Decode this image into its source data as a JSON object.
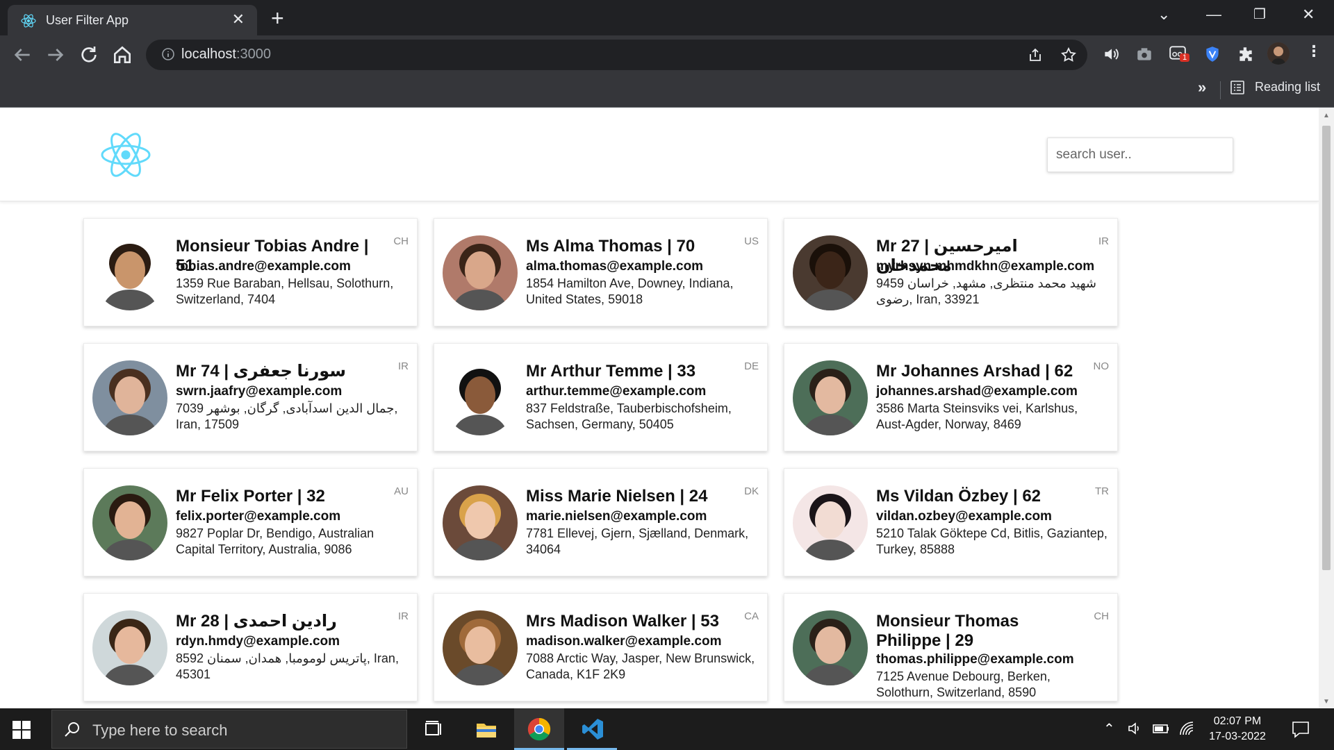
{
  "browser": {
    "tab_title": "User Filter App",
    "url_host": "localhost",
    "url_port": ":3000",
    "reading_list": "Reading list",
    "extension_badge": "1"
  },
  "app": {
    "search_placeholder": "search user.."
  },
  "users": [
    {
      "name": "Monsieur Tobias Andre | 51",
      "email": "tobias.andre@example.com",
      "address": "1359 Rue Baraban, Hellsau, Solothurn, Switzerland, 7404",
      "nat": "CH",
      "skin": "#c9956b",
      "hair": "#2b1c12",
      "bg": "#ffffff"
    },
    {
      "name": "Ms Alma Thomas | 70",
      "email": "alma.thomas@example.com",
      "address": "1854 Hamilton Ave, Downey, Indiana, United States, 59018",
      "nat": "US",
      "skin": "#d9a78a",
      "hair": "#3a2418",
      "bg": "#b07a6a"
    },
    {
      "name": "Mr 27 | امیرحسین محمدخان",
      "email": "myrhsyn.mhmdkhn@example.com",
      "address": "9459 شهید محمد منتظری, مشهد, خراسان رضوی, Iran, 33921",
      "nat": "IR",
      "skin": "#3b2518",
      "hair": "#1a1009",
      "bg": "#4a3a30"
    },
    {
      "name": "Mr 74 | سورنا جعفری",
      "email": "swrn.jaafry@example.com",
      "address": "7039 جمال الدین اسدآبادی, گرگان, بوشهر, Iran, 17509",
      "nat": "IR",
      "skin": "#e0b49a",
      "hair": "#4a3020",
      "bg": "#7f8f9f"
    },
    {
      "name": "Mr Arthur Temme | 33",
      "email": "arthur.temme@example.com",
      "address": "837 Feldstraße, Tauberbischofsheim, Sachsen, Germany, 50405",
      "nat": "DE",
      "skin": "#8a5a3a",
      "hair": "#111111",
      "bg": "#ffffff"
    },
    {
      "name": "Mr Johannes Arshad | 62",
      "email": "johannes.arshad@example.com",
      "address": "3586 Marta Steinsviks vei, Karlshus, Aust-Agder, Norway, 8469",
      "nat": "NO",
      "skin": "#e3b9a0",
      "hair": "#2a2018",
      "bg": "#4d6e58"
    },
    {
      "name": "Mr Felix Porter | 32",
      "email": "felix.porter@example.com",
      "address": "9827 Poplar Dr, Bendigo, Australian Capital Territory, Australia, 9086",
      "nat": "AU",
      "skin": "#e2b394",
      "hair": "#2a1a10",
      "bg": "#5c7a5a"
    },
    {
      "name": "Miss Marie Nielsen | 24",
      "email": "marie.nielsen@example.com",
      "address": "7781 Ellevej, Gjern, Sjælland, Denmark, 34064",
      "nat": "DK",
      "skin": "#efc8ad",
      "hair": "#d9a24a",
      "bg": "#6b4a3a"
    },
    {
      "name": "Ms Vildan Özbey | 62",
      "email": "vildan.ozbey@example.com",
      "address": "5210 Talak Göktepe Cd, Bitlis, Gaziantep, Turkey, 85888",
      "nat": "TR",
      "skin": "#f2dcd3",
      "hair": "#1a1418",
      "bg": "#f4e6e6"
    },
    {
      "name": "Mr 28 | رادین احمدی",
      "email": "rdyn.hmdy@example.com",
      "address": "8592 پاتریس لومومبا, همدان, سمنان, Iran, 45301",
      "nat": "IR",
      "skin": "#e6b89c",
      "hair": "#3a2616",
      "bg": "#cfd8da"
    },
    {
      "name": "Mrs Madison Walker | 53",
      "email": "madison.walker@example.com",
      "address": "7088 Arctic Way, Jasper, New Brunswick, Canada, K1F 2K9",
      "nat": "CA",
      "skin": "#e9bd9f",
      "hair": "#a06a3a",
      "bg": "#6a4a2a"
    },
    {
      "name": "Monsieur Thomas Philippe | 29",
      "email": "thomas.philippe@example.com",
      "address": "7125 Avenue Debourg, Berken, Solothurn, Switzerland, 8590",
      "nat": "CH",
      "skin": "#e3b9a0",
      "hair": "#2a2018",
      "bg": "#4d6e58"
    }
  ],
  "taskbar": {
    "search_text": "Type here to search",
    "time": "02:07 PM",
    "date": "17-03-2022"
  },
  "colors": {
    "react_blue": "#61dafb",
    "chrome_dark": "#202124",
    "chrome_toolbar": "#35363a"
  }
}
